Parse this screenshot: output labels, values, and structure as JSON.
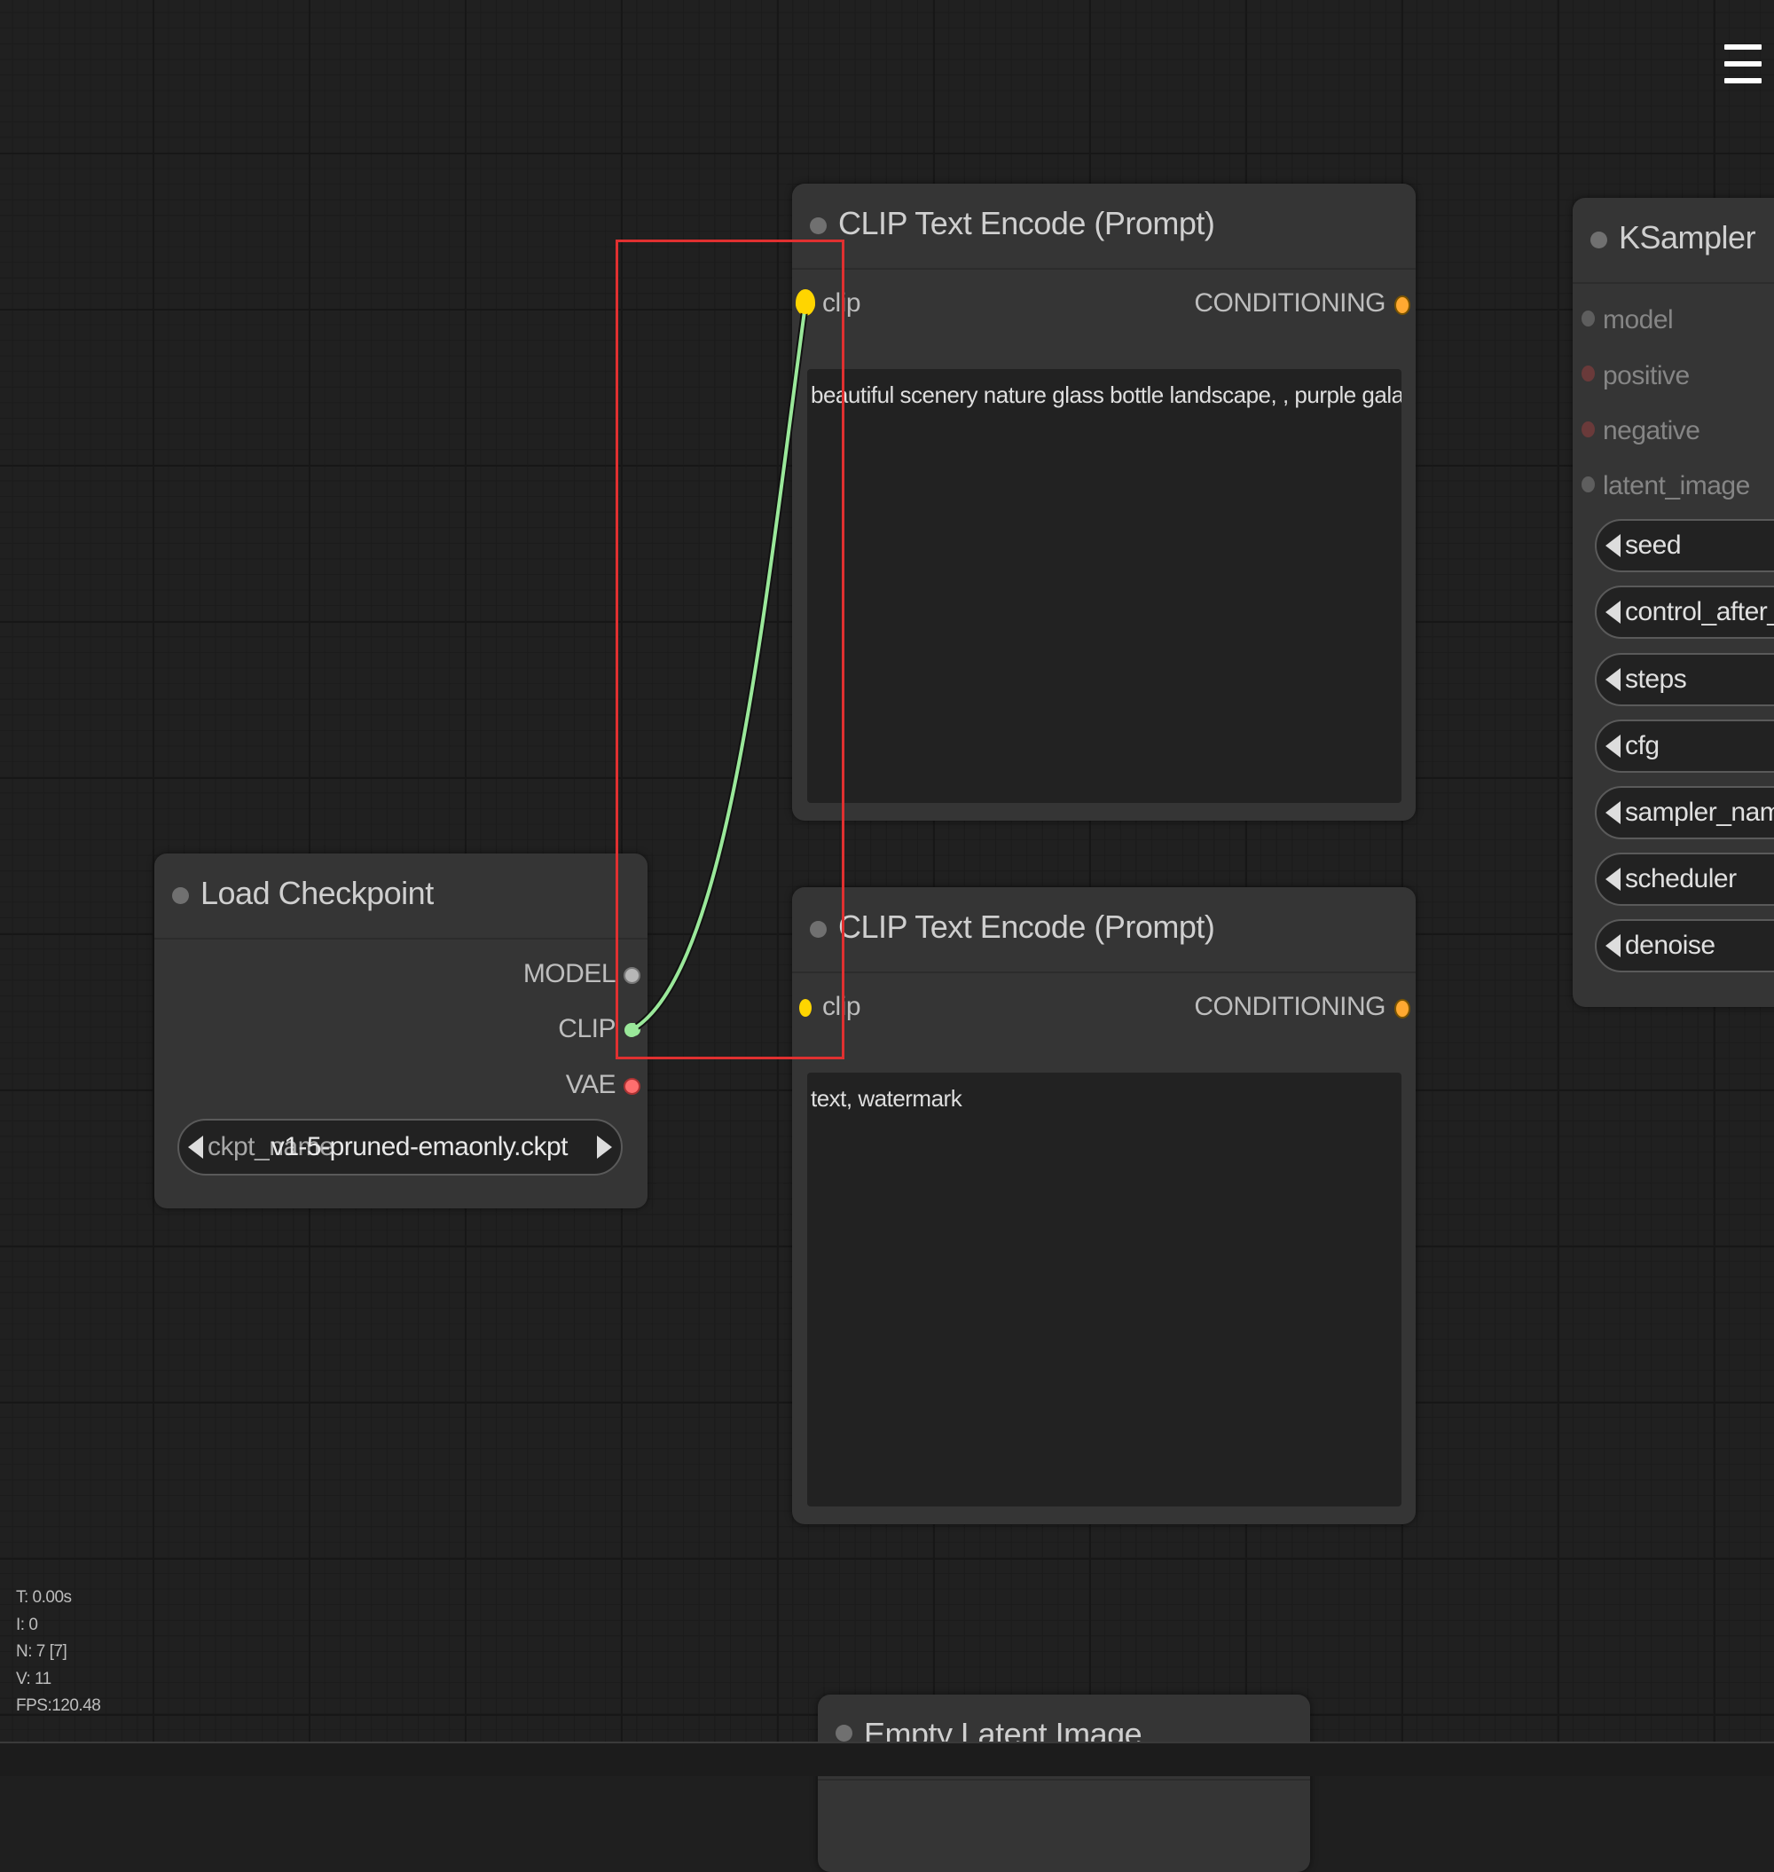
{
  "nodes": {
    "load_checkpoint": {
      "title": "Load Checkpoint",
      "outputs": [
        "MODEL",
        "CLIP",
        "VAE"
      ],
      "widget": {
        "label": "ckpt_name",
        "value": "v1-5-pruned-emaonly.ckpt"
      }
    },
    "clip_text_encode_positive": {
      "title": "CLIP Text Encode (Prompt)",
      "input": "clip",
      "output": "CONDITIONING",
      "text": "beautiful scenery nature glass bottle landscape, , purple galaxy bottle,"
    },
    "clip_text_encode_negative": {
      "title": "CLIP Text Encode (Prompt)",
      "input": "clip",
      "output": "CONDITIONING",
      "text": "text, watermark"
    },
    "ksampler": {
      "title": "KSampler",
      "inputs": [
        "model",
        "positive",
        "negative",
        "latent_image"
      ],
      "widgets": [
        "seed",
        "control_after_gen",
        "steps",
        "cfg",
        "sampler_name",
        "scheduler",
        "denoise"
      ]
    },
    "empty_latent_image": {
      "title": "Empty Latent Image"
    }
  },
  "stats": {
    "time": "T: 0.00s",
    "iterations": "I: 0",
    "nodes": "N: 7 [7]",
    "vertices": "V: 11",
    "fps": "FPS:120.48"
  },
  "colors": {
    "clip_slot": "#ffd500",
    "conditioning_slot": "#ffa931",
    "model_slot": "#b6b6b6",
    "vae_slot": "#ff6e6e",
    "link_clip": "#9ae89a",
    "highlight": "#e03030"
  },
  "icons": {
    "menu": "hamburger-menu-icon"
  }
}
